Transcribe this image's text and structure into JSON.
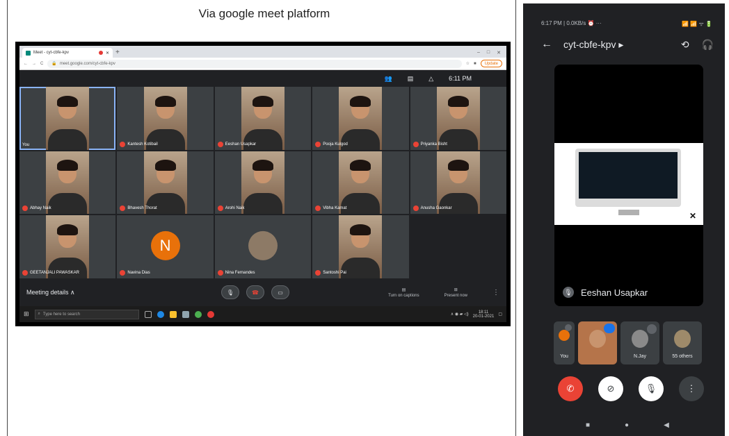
{
  "caption": "Via google meet platform",
  "desktop": {
    "tab_title": "Meet - cyt-cbfe-kpv",
    "new_tab": "+",
    "window_controls": [
      "–",
      "□",
      "✕"
    ],
    "address": "meet.google.com/cyt-cbfe-kpv",
    "update_label": "Update",
    "time": "6:11 PM",
    "participants": [
      {
        "name": "You",
        "type": "video",
        "speaking": true
      },
      {
        "name": "Kantesh Kotibail",
        "type": "video"
      },
      {
        "name": "Eeshan Usapkar",
        "type": "video"
      },
      {
        "name": "Pooja Kulgod",
        "type": "video"
      },
      {
        "name": "Priyanka Bisht",
        "type": "video"
      },
      {
        "name": "Abhay Naik",
        "type": "video"
      },
      {
        "name": "Bhavesh Thorat",
        "type": "video"
      },
      {
        "name": "Arohi Naik",
        "type": "video"
      },
      {
        "name": "Vibha Kamat",
        "type": "video"
      },
      {
        "name": "Anusha Gaonkar",
        "type": "video"
      },
      {
        "name": "GEETANJALI PAWASKAR",
        "type": "video"
      },
      {
        "name": "Navina Dias",
        "type": "avatar",
        "initial": "N"
      },
      {
        "name": "Nina Fernandes",
        "type": "avatar-photo"
      },
      {
        "name": "Santoshi Pai",
        "type": "video"
      }
    ],
    "meeting_details": "Meeting details ∧",
    "captions_label": "Turn on captions",
    "present_label": "Present now",
    "more_label": "⋮",
    "taskbar_search": "Type here to search",
    "tray_time": "18:11",
    "tray_date": "20-01-2021"
  },
  "phone": {
    "status_left": "6:17 PM | 0.0KB/s ⏰ ···",
    "status_right": "📶 📶 ᯤ 🔋",
    "back": "←",
    "meeting_code": "cyt-cbfe-kpv ▸",
    "switch_icon": "⟲",
    "audio_icon": "🎧",
    "speaker_name": "Eeshan Usapkar",
    "thumbs": [
      {
        "label": "You",
        "kind": "you"
      },
      {
        "label": "",
        "kind": "active"
      },
      {
        "label": "N.Jay",
        "kind": "muted"
      },
      {
        "label": "55 others",
        "kind": "group"
      }
    ],
    "controls": [
      "✆",
      "⊘",
      "🎙",
      "⋮"
    ],
    "nav": [
      "■",
      "●",
      "◀"
    ]
  }
}
